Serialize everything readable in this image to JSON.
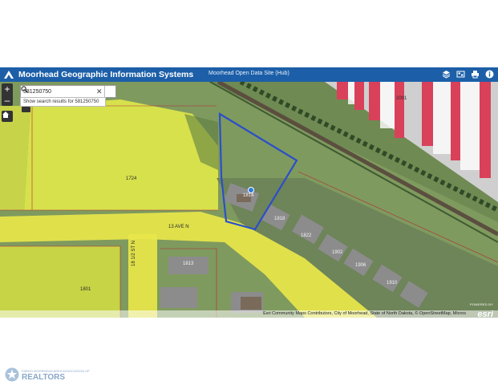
{
  "header": {
    "title": "Moorhead Geographic Information Systems",
    "hub_link": "Moorhead Open Data Site (Hub)",
    "tools": [
      "layers-icon",
      "basemap-icon",
      "print-icon",
      "info-icon"
    ]
  },
  "search": {
    "value": "581250750",
    "suggestion_prefix": "Show search results for",
    "suggestion_value": "581250750"
  },
  "map": {
    "zoom_in": "+",
    "zoom_out": "–",
    "labels": {
      "parcel_1724": "1724",
      "parcel_1814": "1814",
      "parcel_1818": "1818",
      "parcel_1822": "1822",
      "parcel_1902": "1902",
      "parcel_1906": "1906",
      "parcel_1910": "1910",
      "parcel_1813": "1813",
      "parcel_1801": "1801",
      "parcel_2001": "2001",
      "street_13_ave": "13 AVE N",
      "street_18_half": "18 1/2 ST N"
    },
    "attribution": "Esri Community Maps Contributors, City of Moorhead, State of North Dakota, © OpenStreetMap, Micros",
    "esri_powered": "POWERED BY",
    "esri_name": "esri"
  },
  "footer": {
    "line1": "FARGO MOORHEAD AREA ASSOCIATION OF",
    "line2": "REALTORS"
  },
  "colors": {
    "header": "#1c5fa8",
    "selection": "#2b4fc9",
    "zoning_yellow": "#e8e64a",
    "parcel_line": "#b3273a"
  }
}
